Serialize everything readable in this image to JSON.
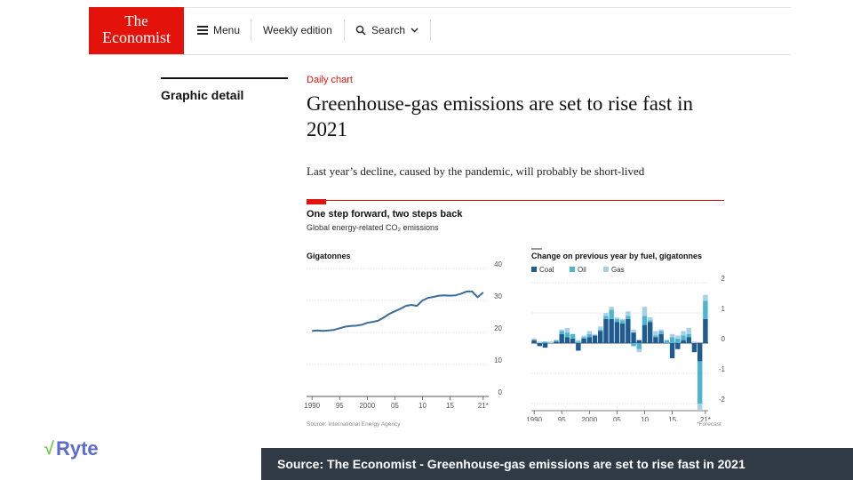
{
  "header": {
    "logo_line1": "The",
    "logo_line2": "Economist",
    "menu_label": "Menu",
    "weekly_label": "Weekly edition",
    "search_label": "Search",
    "colors": {
      "brand": "#e3120b"
    }
  },
  "section": {
    "label": "Graphic detail"
  },
  "article": {
    "kicker": "Daily chart",
    "headline": "Greenhouse-gas emissions are set to rise fast in 2021",
    "subhead": "Last year’s decline, caused by the pandemic, will probably be short-lived"
  },
  "chart": {
    "title": "One step forward, two steps back",
    "subtitle": "Global energy-related CO₂ emissions",
    "source": "Source: International Energy Agency",
    "note": "*Forecast"
  },
  "chart_data": [
    {
      "type": "line",
      "ylabel": "Gigatonnes",
      "ylim": [
        0,
        40
      ],
      "yticks": [
        0,
        10,
        20,
        30,
        40
      ],
      "x_tick_labels": [
        "1990",
        "95",
        "2000",
        "05",
        "10",
        "15",
        "21*"
      ],
      "x_tick_years": [
        1990,
        1995,
        2000,
        2005,
        2010,
        2015,
        2021
      ],
      "x": [
        1990,
        1991,
        1992,
        1993,
        1994,
        1995,
        1996,
        1997,
        1998,
        1999,
        2000,
        2001,
        2002,
        2003,
        2004,
        2005,
        2006,
        2007,
        2008,
        2009,
        2010,
        2011,
        2012,
        2013,
        2014,
        2015,
        2016,
        2017,
        2018,
        2019,
        2020,
        2021
      ],
      "series": [
        {
          "values": [
            20.5,
            20.6,
            20.5,
            20.6,
            20.8,
            21.3,
            21.8,
            22.0,
            22.1,
            22.4,
            23.0,
            23.3,
            23.7,
            24.7,
            25.8,
            26.6,
            27.4,
            28.3,
            28.6,
            28.3,
            30.0,
            30.8,
            31.1,
            31.5,
            31.6,
            31.5,
            31.6,
            32.1,
            32.8,
            32.8,
            31.0,
            32.5
          ],
          "color": "#3a6d9a"
        }
      ]
    },
    {
      "type": "bar",
      "stacked": true,
      "title": "Change on previous year by fuel, gigatonnes",
      "ylim": [
        -2,
        2
      ],
      "yticks": [
        2,
        1,
        0,
        -1,
        -2
      ],
      "x_tick_labels": [
        "1990",
        "95",
        "2000",
        "05",
        "10",
        "15",
        "21*"
      ],
      "x_tick_years": [
        1990,
        1995,
        2000,
        2005,
        2010,
        2015,
        2021
      ],
      "categories": [
        1990,
        1991,
        1992,
        1993,
        1994,
        1995,
        1996,
        1997,
        1998,
        1999,
        2000,
        2001,
        2002,
        2003,
        2004,
        2005,
        2006,
        2007,
        2008,
        2009,
        2010,
        2011,
        2012,
        2013,
        2014,
        2015,
        2016,
        2017,
        2018,
        2019,
        2020,
        2021
      ],
      "series": [
        {
          "name": "Coal",
          "color": "#1f5b8e",
          "values": [
            0.1,
            -0.1,
            -0.15,
            0.0,
            0.05,
            0.3,
            0.2,
            0.15,
            -0.25,
            0.15,
            0.2,
            0.25,
            0.4,
            0.8,
            0.8,
            0.7,
            0.65,
            0.8,
            0.35,
            0.1,
            0.6,
            0.7,
            0.2,
            0.3,
            0.0,
            -0.5,
            -0.2,
            0.1,
            0.2,
            -0.3,
            -0.6,
            0.8
          ]
        },
        {
          "name": "Oil",
          "color": "#4fb3d2",
          "values": [
            0.0,
            0.0,
            0.05,
            0.0,
            0.05,
            0.1,
            0.15,
            0.15,
            0.05,
            0.05,
            0.1,
            0.0,
            0.05,
            0.1,
            0.3,
            0.1,
            0.1,
            0.1,
            -0.1,
            -0.2,
            0.3,
            0.05,
            0.05,
            0.1,
            0.1,
            0.2,
            0.15,
            0.15,
            0.1,
            0.0,
            -1.4,
            0.6
          ]
        },
        {
          "name": "Gas",
          "color": "#a6d1e6",
          "values": [
            0.05,
            0.05,
            0.0,
            0.05,
            0.0,
            0.05,
            0.15,
            0.0,
            0.05,
            0.05,
            0.1,
            0.05,
            0.1,
            0.1,
            0.1,
            0.05,
            0.05,
            0.15,
            0.1,
            -0.1,
            0.3,
            0.1,
            0.15,
            0.05,
            0.0,
            0.1,
            0.1,
            0.15,
            0.2,
            0.05,
            -0.2,
            0.2
          ]
        }
      ]
    }
  ],
  "footer": {
    "brand": "Ryte",
    "brand_mark": "√",
    "banner": "Source: The Economist - Greenhouse-gas emissions are set to rise fast in 2021"
  }
}
